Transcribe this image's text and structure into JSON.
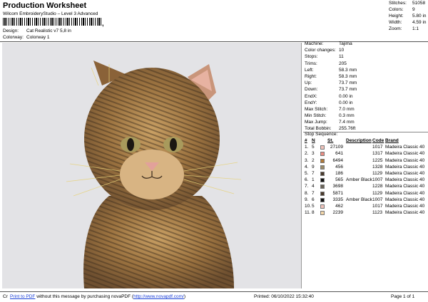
{
  "header": {
    "title": "Production Worksheet",
    "subtitle": "Wilcom EmbroideryStudio – Level 3 Advanced",
    "barcode_tail": ","
  },
  "design": {
    "label": "Design:",
    "value": "Cat Realistic v7 5,8 in"
  },
  "colorway": {
    "label": "Colorway:",
    "value": "Colorway 1"
  },
  "stats": [
    {
      "label": "Stitches:",
      "value": "51058"
    },
    {
      "label": "Colors:",
      "value": "9"
    },
    {
      "label": "Height:",
      "value": "5.80 in"
    },
    {
      "label": "Width:",
      "value": "4.59 in"
    },
    {
      "label": "Zoom:",
      "value": "1:1"
    }
  ],
  "machine_info": [
    {
      "label": "Machine:",
      "value": "Tajima"
    },
    {
      "label": "Color changes:",
      "value": "10"
    },
    {
      "label": "Stops:",
      "value": "11"
    },
    {
      "label": "Trims:",
      "value": "205"
    },
    {
      "label": "Left:",
      "value": "58.3 mm"
    },
    {
      "label": "Right:",
      "value": "58.3 mm"
    },
    {
      "label": "Up:",
      "value": "73.7 mm"
    },
    {
      "label": "Down:",
      "value": "73.7 mm"
    },
    {
      "label": "EndX:",
      "value": "0.00 in"
    },
    {
      "label": "EndY:",
      "value": "0.00 in"
    },
    {
      "label": "Max Stitch:",
      "value": "7.0 mm"
    },
    {
      "label": "Min Stitch:",
      "value": "0.3 mm"
    },
    {
      "label": "Max Jump:",
      "value": "7.4 mm"
    },
    {
      "label": "Total Bobbin:",
      "value": "255.76ft"
    }
  ],
  "stop_sequence": {
    "title": "Stop Sequence:",
    "headers": {
      "hash": "#",
      "n": "N",
      "stitches": "St.",
      "description": "Description",
      "code": "Code",
      "brand": "Brand"
    },
    "rows": [
      {
        "hash": "1.",
        "n": "5",
        "color": "#f1c3bb",
        "stitches": "27109",
        "description": "",
        "code": "1017",
        "brand": "Madeira Classic 40"
      },
      {
        "hash": "2.",
        "n": "3",
        "color": "#e98d83",
        "stitches": "641",
        "description": "",
        "code": "1317",
        "brand": "Madeira Classic 40"
      },
      {
        "hash": "3.",
        "n": "2",
        "color": "#b07a3a",
        "stitches": "6494",
        "description": "",
        "code": "1225",
        "brand": "Madeira Classic 40"
      },
      {
        "hash": "4.",
        "n": "9",
        "color": "#9a8c6a",
        "stitches": "456",
        "description": "",
        "code": "1328",
        "brand": "Madeira Classic 40"
      },
      {
        "hash": "5.",
        "n": "7",
        "color": "#4a3a2c",
        "stitches": "186",
        "description": "",
        "code": "1129",
        "brand": "Madeira Classic 40"
      },
      {
        "hash": "6.",
        "n": "1",
        "color": "#111111",
        "stitches": "565",
        "description": "Amber Black",
        "code": "1007",
        "brand": "Madeira Classic 40"
      },
      {
        "hash": "7.",
        "n": "4",
        "color": "#6a6458",
        "stitches": "3698",
        "description": "",
        "code": "1228",
        "brand": "Madeira Classic 40"
      },
      {
        "hash": "8.",
        "n": "7",
        "color": "#4a3a2c",
        "stitches": "5871",
        "description": "",
        "code": "1129",
        "brand": "Madeira Classic 40"
      },
      {
        "hash": "9.",
        "n": "6",
        "color": "#111111",
        "stitches": "3335",
        "description": "Amber Black",
        "code": "1007",
        "brand": "Madeira Classic 40"
      },
      {
        "hash": "10.",
        "n": "5",
        "color": "#f1c3bb",
        "stitches": "462",
        "description": "",
        "code": "1017",
        "brand": "Madeira Classic 40"
      },
      {
        "hash": "11.",
        "n": "8",
        "color": "#f2d6a8",
        "stitches": "2239",
        "description": "",
        "code": "1123",
        "brand": "Madeira Classic 40"
      }
    ]
  },
  "footer": {
    "cr": "Cr",
    "print_link": "Print to PDF",
    "message_mid": " without this message by purchasing novaPDF (",
    "url": "http://www.novapdf.com/",
    "message_end": ")",
    "printed": "Printed: 06/10/2022 15:32:40",
    "page": "Page 1 of 1"
  },
  "colors": {
    "background": "#e3e3e6",
    "link": "#1a3fd6"
  }
}
